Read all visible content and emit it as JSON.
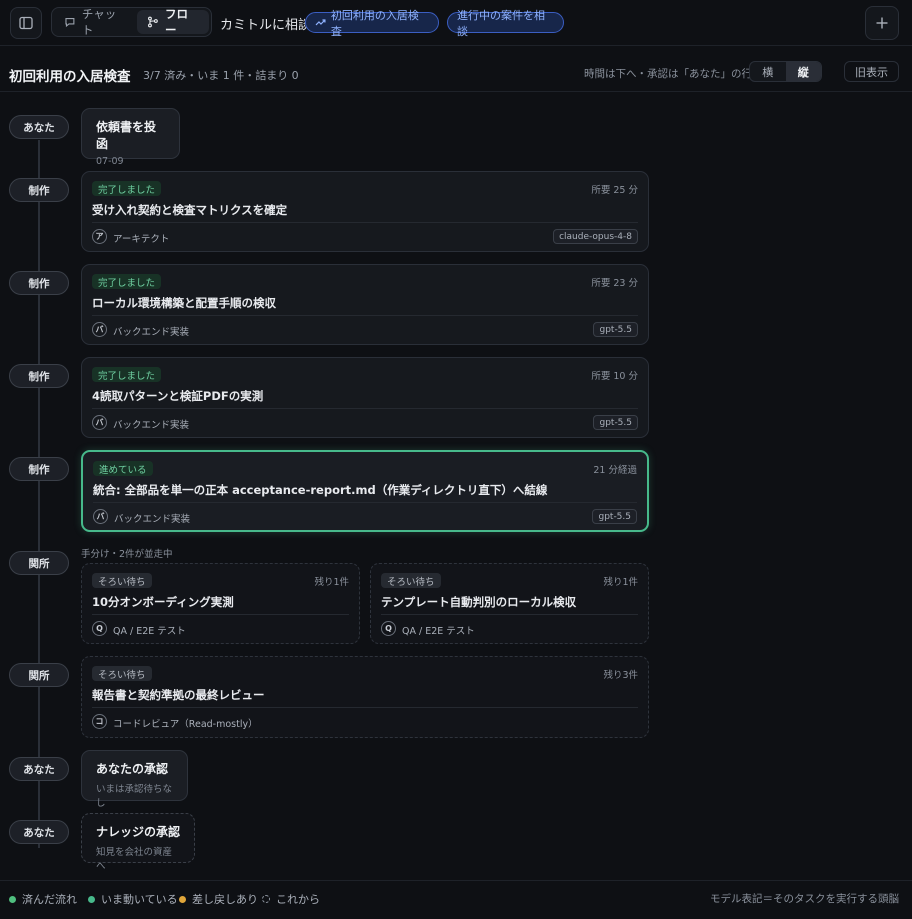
{
  "topbar": {
    "tabs": [
      {
        "label": "チャット",
        "icon": "chat-bubble-icon",
        "active": false
      },
      {
        "label": "フロー",
        "icon": "flow-icon",
        "active": true
      }
    ],
    "ask_label": "カミトルに相談",
    "pill_onboarding": "初回利用の入居検査",
    "pill_ongoing": "進行中の案件を相談",
    "add_icon": "plus-icon",
    "sidebar_icon": "sidebar-toggle-icon"
  },
  "subbar": {
    "title": "初回利用の入居検査",
    "progress": "3/7 済み・いま 1 件・詰まり 0",
    "hint": "時間は下へ・承認は「あなた」の行",
    "orient_horizontal": "横",
    "orient_vertical": "縦",
    "legacy_view": "旧表示"
  },
  "flow": {
    "step1": {
      "badge": "あなた",
      "title": "依頼書を投函",
      "sub": "07-09"
    },
    "step2": {
      "badge": "制作",
      "status": "完了しました",
      "duration": "所要 25 分",
      "title": "受け入れ契約と検査マトリクスを確定",
      "role_initial": "ア",
      "role": "アーキテクト",
      "model": "claude-opus-4-8"
    },
    "step3": {
      "badge": "制作",
      "status": "完了しました",
      "duration": "所要 23 分",
      "title": "ローカル環境構築と配置手順の検収",
      "role_initial": "バ",
      "role": "バックエンド実装",
      "model": "gpt-5.5"
    },
    "step4": {
      "badge": "制作",
      "status": "完了しました",
      "duration": "所要 10 分",
      "title": "4読取パターンと検証PDFの実測",
      "role_initial": "バ",
      "role": "バックエンド実装",
      "model": "gpt-5.5"
    },
    "step5": {
      "badge": "制作",
      "status": "進めている",
      "duration": "21 分経過",
      "title": "統合: 全部品を単一の正本 acceptance-report.md（作業ディレクトリ直下）へ結線",
      "role_initial": "バ",
      "role": "バックエンド実装",
      "model": "gpt-5.5"
    },
    "step6": {
      "badge": "関所",
      "parallel_label": "手分け・2件が並走中",
      "left": {
        "status": "そろい待ち",
        "remaining": "残り1件",
        "title": "10分オンボーディング実測",
        "role_initial": "Q",
        "role": "QA / E2E テスト"
      },
      "right": {
        "status": "そろい待ち",
        "remaining": "残り1件",
        "title": "テンプレート自動判別のローカル検収",
        "role_initial": "Q",
        "role": "QA / E2E テスト"
      }
    },
    "step7": {
      "badge": "関所",
      "status": "そろい待ち",
      "remaining": "残り3件",
      "title": "報告書と契約準拠の最終レビュー",
      "role_initial": "コ",
      "role": "コードレビュア（Read-mostly）"
    },
    "step8": {
      "badge": "あなた",
      "title": "あなたの承認",
      "sub": "いまは承認待ちなし"
    },
    "step9": {
      "badge": "あなた",
      "title": "ナレッジの承認",
      "sub": "知見を会社の資産へ"
    }
  },
  "footer": {
    "legend": [
      {
        "label": "済んだ流れ",
        "color": "#4fbf7f"
      },
      {
        "label": "いま動いている",
        "color": "#47b98b"
      },
      {
        "label": "差し戻しあり",
        "color": "#e0a63a"
      },
      {
        "label": "これから",
        "color": "#8a919c"
      }
    ],
    "note": "モデル表記＝そのタスクを実行する頭脳"
  }
}
